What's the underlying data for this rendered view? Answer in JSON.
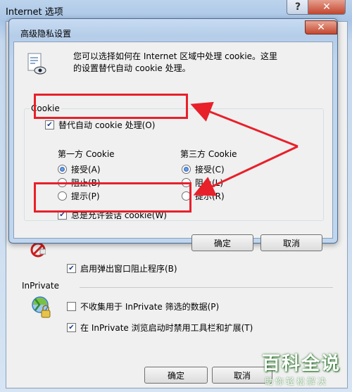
{
  "outer_window": {
    "title": "Internet 选项",
    "help_label": "?",
    "close_label": "✕",
    "popup_blocker_label": "启用弹出窗口阻止程序(B)",
    "inprivate_section": "InPrivate",
    "inprivate_no_collect": "不收集用于 InPrivate 筛选的数据(P)",
    "inprivate_disable_toolbars": "在 InPrivate 浏览启动时禁用工具栏和扩展(T)",
    "ok_label": "确定",
    "cancel_label": "取消"
  },
  "dialog": {
    "title": "高级隐私设置",
    "close_label": "✕",
    "description_line1": "您可以选择如何在 Internet 区域中处理 cookie。这里",
    "description_line2": "的设置替代自动 cookie 处理。",
    "cookie_group_label": "Cookie",
    "override_auto_label": "替代自动 cookie 处理(O)",
    "first_party_label": "第一方 Cookie",
    "third_party_label": "第三方 Cookie",
    "first_party_options": [
      "接受(A)",
      "阻止(B)",
      "提示(P)"
    ],
    "third_party_options": [
      "接受(C)",
      "阻止(L)",
      "提示(R)"
    ],
    "first_party_selected": "接受(A)",
    "third_party_selected": "接受(C)",
    "session_cookie_label": "总是允许会话 cookie(W)",
    "ok_label": "确定",
    "cancel_label": "取消"
  },
  "watermark": {
    "main": "百科全说",
    "sub": "助你轻松解决"
  },
  "colors": {
    "highlight": "#e8202a",
    "title_gradient": "#b5cde9",
    "close_red": "#c3472f"
  }
}
